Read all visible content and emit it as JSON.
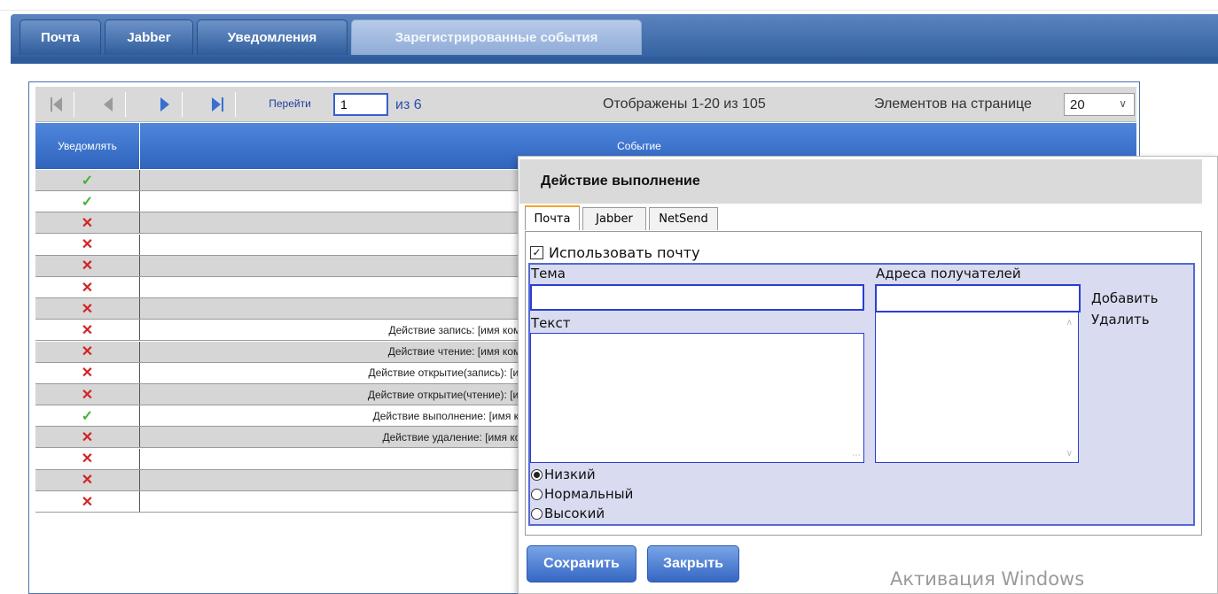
{
  "tabs": [
    "Почта",
    "Jabber",
    "Уведомления",
    "Зарегистрированные события"
  ],
  "pager": {
    "go_label": "Перейти",
    "page_value": "1",
    "page_of": "из 6",
    "display_info": "Отображены 1-20 из 105",
    "per_page_label": "Элементов на странице",
    "per_page_value": "20"
  },
  "table": {
    "headers": [
      "Уведомлять",
      "Событие"
    ],
    "rows": [
      {
        "notify": "✓",
        "enabled": true,
        "event": ""
      },
      {
        "notify": "✓",
        "enabled": true,
        "event": ""
      },
      {
        "notify": "✕",
        "enabled": false,
        "event": ""
      },
      {
        "notify": "✕",
        "enabled": false,
        "event": ""
      },
      {
        "notify": "✕",
        "enabled": false,
        "event": ""
      },
      {
        "notify": "✕",
        "enabled": false,
        "event": ""
      },
      {
        "notify": "✕",
        "enabled": false,
        "event": ""
      },
      {
        "notify": "✕",
        "enabled": false,
        "event": "Действие запись: [имя компь"
      },
      {
        "notify": "✕",
        "enabled": false,
        "event": "Действие чтение: [имя компь"
      },
      {
        "notify": "✕",
        "enabled": false,
        "event": "Действие открытие(запись): [имя"
      },
      {
        "notify": "✕",
        "enabled": false,
        "event": "Действие открытие(чтение): [имя"
      },
      {
        "notify": "✓",
        "enabled": true,
        "event": "Действие выполнение: [имя ком"
      },
      {
        "notify": "✕",
        "enabled": false,
        "event": "Действие удаление: [имя комг"
      },
      {
        "notify": "✕",
        "enabled": false,
        "event": ""
      },
      {
        "notify": "✕",
        "enabled": false,
        "event": ""
      },
      {
        "notify": "✕",
        "enabled": false,
        "event": ""
      }
    ]
  },
  "dialog": {
    "title": "Действие выполнение",
    "tabs": [
      "Почта",
      "Jabber",
      "NetSend"
    ],
    "use_mail_label": "Использовать почту",
    "use_mail_checked": true,
    "subject_label": "Тема",
    "subject_value": "",
    "text_label": "Текст",
    "text_value": "",
    "recipients_label": "Адреса получателей",
    "recipient_value": "",
    "add_label": "Добавить",
    "remove_label": "Удалить",
    "priorities": [
      "Низкий",
      "Нормальный",
      "Высокий"
    ],
    "priority_selected": "Низкий",
    "save_label": "Сохранить",
    "close_label": "Закрыть"
  },
  "watermark": "Активация Windows",
  "colors": {
    "accent": "#2f64bd",
    "check": "#45b23a",
    "cross": "#d42222",
    "form_bg": "#d9dbf0"
  },
  "icons": [
    "first-page-icon",
    "prev-page-icon",
    "next-page-icon",
    "last-page-icon",
    "chevron-down-icon"
  ]
}
